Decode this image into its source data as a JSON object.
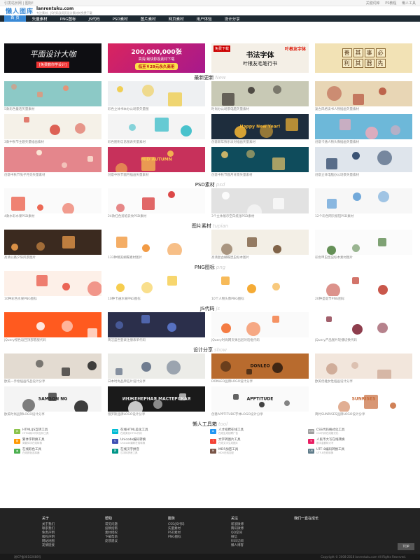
{
  "topbar": {
    "left": "引发站长网 | 图标!",
    "links": [
      "关键词库",
      "PS教程",
      "懒人工具"
    ]
  },
  "logo": {
    "cn": "懒人图库",
    "en": "lanrentuku.com",
    "slogan": "专注素材、JS代码及网页设计素材的免费下载"
  },
  "nav": [
    "首 页",
    "矢量素材",
    "PNG图标",
    "JS代码",
    "PSD素材",
    "图片素材",
    "网页素材",
    "用户体验",
    "设计分享"
  ],
  "banners": {
    "b1": {
      "title": "平面设计大咖",
      "sub": "[免费教你学设计]"
    },
    "b2": {
      "title": "200,000,000张",
      "sub": "高清/最快影视素材下载",
      "cta": "低至￥29元永久商用"
    },
    "b3": {
      "tag": "免费下载",
      "title": "书法字体",
      "sub": "叶根友毛笔行书",
      "tag2": "叶根友字体"
    },
    "b4": {
      "chars": [
        "善",
        "其",
        "事",
        "必",
        "利",
        "其",
        "器",
        "先"
      ]
    }
  },
  "sections": [
    {
      "title": "最新更新",
      "en": "New",
      "rows": [
        [
          {
            "cap": "5款彩色童话矢量素材",
            "bg": "#8cc9c6",
            "accent": "#f28b6b"
          },
          {
            "cap": "彩色立体书本办公场景矢量图",
            "bg": "#eef0f2",
            "accent": "#f0c93a"
          },
          {
            "cap": "时尚办公场景电脑矢量素材",
            "bg": "#c8c9b5",
            "accent": "#3a3530"
          },
          {
            "cap": "复古风格读书人物插画矢量素材",
            "bg": "#e8d6b5",
            "accent": "#b5503a"
          }
        ],
        [
          {
            "cap": "3款中秋节主题矢量插画素材",
            "bg": "#f5f1e8",
            "accent": "#d8483a"
          },
          {
            "cap": "彩色图形信息图表矢量素材",
            "bg": "#f4f4f4",
            "accent": "#2ab8c4"
          },
          {
            "cap": "创意新年快乐派对插画矢量素材",
            "bg": "#1e2d3d",
            "accent": "#f7b733",
            "label": "Happy New Year!"
          },
          {
            "cap": "创意卡通人物头像插画矢量素材",
            "bg": "#6db8d9",
            "accent": "#f0a9b8"
          }
        ],
        [
          {
            "cap": "创意中秋节兔子月亮矢量素材",
            "bg": "#e4868c",
            "accent": "#fff4e0"
          },
          {
            "cap": "创意中秋节圆月插画矢量素材",
            "bg": "#c7315b",
            "accent": "#f9c74f",
            "label": "MID AUTUMN"
          },
          {
            "cap": "创意中秋节圆月背景矢量素材",
            "bg": "#0f4c5c",
            "accent": "#e9c46a"
          },
          {
            "cap": "创意立体电脑办公场景矢量素材",
            "bg": "#dfe5ec",
            "accent": "#1f3a5f"
          }
        ]
      ]
    },
    {
      "title": "PSD素材",
      "en": "psd",
      "rows": [
        [
          {
            "cap": "4款水彩水果PSD素材",
            "bg": "#fafafa",
            "accent": "#e94f37"
          },
          {
            "cap": "24款红色剪纸云纹PSD素材",
            "bg": "#fbfbfb",
            "accent": "#d62828"
          },
          {
            "cap": "3个立体展示空白纸张PSD素材",
            "bg": "#e2e2e2",
            "accent": "#ffffff"
          },
          {
            "cap": "12个彩色网页按钮PSD素材",
            "bg": "#f7f7f7",
            "accent": "#5a9bd5"
          }
        ]
      ]
    },
    {
      "title": "图片素材",
      "en": "tupian",
      "rows": [
        [
          {
            "cap": "高清公路夕阳风景图片",
            "bg": "#3b2a1f",
            "accent": "#f6a24d"
          },
          {
            "cap": "133种精美蝴蝶素材图片",
            "bg": "#ffffff",
            "accent": "#f08a24"
          },
          {
            "cap": "高清复古蝴蝶昆虫标本图片",
            "bg": "#f3efe6",
            "accent": "#6b4a2b"
          },
          {
            "cap": "彩色甲虫昆虫标本素材图片",
            "bg": "#fbfbfb",
            "accent": "#4a7c3a"
          }
        ]
      ]
    },
    {
      "title": "PNG图标",
      "en": "png",
      "rows": [
        [
          {
            "cap": "10种彩色水果PNG图标",
            "bg": "#fdf0e8",
            "accent": "#e74c3c"
          },
          {
            "cap": "10种卡通水果PNG图标",
            "bg": "#ffffff",
            "accent": "#f4c430"
          },
          {
            "cap": "10个人物头像PNG图标",
            "bg": "#ffffff",
            "accent": "#f39c12"
          },
          {
            "cap": "20种圣诞节PNG图标",
            "bg": "#ffffff",
            "accent": "#c0392b"
          }
        ]
      ]
    },
    {
      "title": "JS代码",
      "en": "js",
      "rows": [
        [
          {
            "cap": "jQuery橙色返回顶部客服代码",
            "bg": "#ff5a1f",
            "accent": "#ffffff"
          },
          {
            "cap": "简洁蓝色登录注册表单代码",
            "bg": "#2b2f4b",
            "accent": "#5f7cd6"
          },
          {
            "cap": "jQuery时尚网页弹出层对话框代码",
            "bg": "#fafafa",
            "accent": "#f26522"
          },
          {
            "cap": "jQuery产品图片轮播切换代码",
            "bg": "#ffffff",
            "accent": "#7a1c2e"
          }
        ]
      ]
    },
    {
      "title": "设计分享",
      "en": "show",
      "rows": [
        [
          {
            "cap": "欧美一手绘插画作品设计分享",
            "bg": "#e3dbd1",
            "accent": "#222222"
          },
          {
            "cap": "日本时尚品牌名片设计分享",
            "bg": "#ecece8",
            "accent": "#5a6a80"
          },
          {
            "cap": "DONLEO品牌LOGO设计分享",
            "bg": "#b86b2e",
            "accent": "#2a1a0e",
            "label": "DONLEO"
          },
          {
            "cap": "欧美优雅女性插画设计分享",
            "bg": "#f2e6dc",
            "accent": "#caa28e"
          }
        ],
        [
          {
            "cap": "欧美时尚品牌LOGO设计分享",
            "bg": "#f4f4f4",
            "accent": "#1b1b1b",
            "label": "SAMSON NG"
          },
          {
            "cap": "俄罗斯品牌LOGO设计分享",
            "bg": "#1a1a1a",
            "accent": "#e8e8e8",
            "label": "ИНЖЕНЕРНАЯ МАСТЕРСКАЯ"
          },
          {
            "cap": "创意APPTITUDE字体LOGO设计分享",
            "bg": "#fafafa",
            "accent": "#222222",
            "label": "APPTITUDE"
          },
          {
            "cap": "简约SUNRISES品牌LOGO设计分享",
            "bg": "#ffffff",
            "accent": "#c86b3a",
            "label": "SUNRISES"
          }
        ]
      ]
    }
  ],
  "tools_section": {
    "title": "懒人工具箱",
    "en": "tool"
  },
  "tools": [
    {
      "name": "HTML/JS互转工具",
      "desc": "HTML和JS代码互转工具",
      "color": "#8bc34a",
      "icon": "JS"
    },
    {
      "name": "在线HTML美化工具",
      "desc": "在线美化HTML代码",
      "color": "#00bcd4",
      "icon": "</>"
    },
    {
      "name": "人才招聘在线工具",
      "desc": "在线生成招聘广告",
      "color": "#2196f3",
      "icon": "Ai"
    },
    {
      "name": "CSS代码格式化工具",
      "desc": "CSS代码在线格式化",
      "color": "#9e9e9e",
      "icon": "CSS"
    },
    {
      "name": "繁体字转换工具",
      "desc": "简繁体字在线转换",
      "color": "#ff9800",
      "icon": "繁"
    },
    {
      "name": "Unicode编码转换",
      "desc": "Unicode编码在线转换",
      "color": "#3f51b5",
      "icon": "U"
    },
    {
      "name": "文字转图片工具",
      "desc": "在线文字生成图片",
      "color": "#f44336",
      "icon": "T"
    },
    {
      "name": "人民币大写在线转换",
      "desc": "数字金额转大写",
      "color": "#e91e63",
      "icon": "¥"
    },
    {
      "name": "在线取色工具",
      "desc": "在线颜色选择器",
      "color": "#4caf50",
      "icon": "◉"
    },
    {
      "name": "在线汉字拼音",
      "desc": "汉字转拼音工具",
      "color": "#009688",
      "icon": "拼"
    },
    {
      "name": "MD5加密工具",
      "desc": "MD5在线加密",
      "color": "#795548",
      "icon": "M"
    },
    {
      "name": "UTF-8编码转换工具",
      "desc": "UTF-8在线转换",
      "color": "#607d8b",
      "icon": "U8"
    }
  ],
  "footer": {
    "cols": [
      {
        "h": "关于",
        "items": [
          "关于我们",
          "联系我们",
          "免责声明",
          "版权声明",
          "网站地图",
          "友情链接"
        ]
      },
      {
        "h": "帮助",
        "items": [
          "常见问题",
          "投稿指南",
          "素材授权",
          "下载帮助",
          "反馈建议"
        ]
      },
      {
        "h": "服务",
        "items": [
          "CSS/JS代码",
          "矢量素材",
          "PSD素材",
          "PNG图标"
        ]
      },
      {
        "h": "关注",
        "items": [
          "新浪微博",
          "腾讯微博",
          "QQ空间",
          "微信",
          "RSS订阅",
          "懒人博客"
        ]
      },
      {
        "h": "我们一直在成长",
        "items": []
      }
    ],
    "left": "湘ICP备08102688号",
    "copy": "Copyright © 2008-2018 lanrentuku.com All Rights Reserved.",
    "totop": "TOP"
  }
}
